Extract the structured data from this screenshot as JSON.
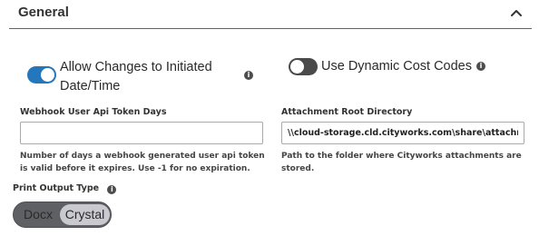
{
  "section": {
    "title": "General",
    "collapse_icon": "chevron-up-icon"
  },
  "toggles": {
    "allow_changes": {
      "label": "Allow Changes to Initiated Date/Time",
      "state": "on",
      "info_glyph": "i"
    },
    "dynamic_cost_codes": {
      "label": "Use Dynamic Cost Codes",
      "state": "off",
      "info_glyph": "i"
    }
  },
  "fields": {
    "webhook_token_days": {
      "label": "Webhook User Api Token Days",
      "value": "",
      "help": "Number of days a webhook generated user api token is valid before it expires. Use -1 for no expiration."
    },
    "attachment_root": {
      "label": "Attachment Root Directory",
      "value": "\\\\cloud-storage.cld.cityworks.com\\share\\attachments",
      "help": "Path to the folder where Cityworks attachments are stored."
    }
  },
  "print_output": {
    "label": "Print Output Type",
    "info_glyph": "i",
    "options": [
      "Docx",
      "Crystal"
    ],
    "selected": "Crystal"
  },
  "colors": {
    "accent": "#2477bd",
    "toggle_off": "#4a4a4a",
    "segment_bg": "#5f6064",
    "segment_selected": "#c9c9cf"
  }
}
